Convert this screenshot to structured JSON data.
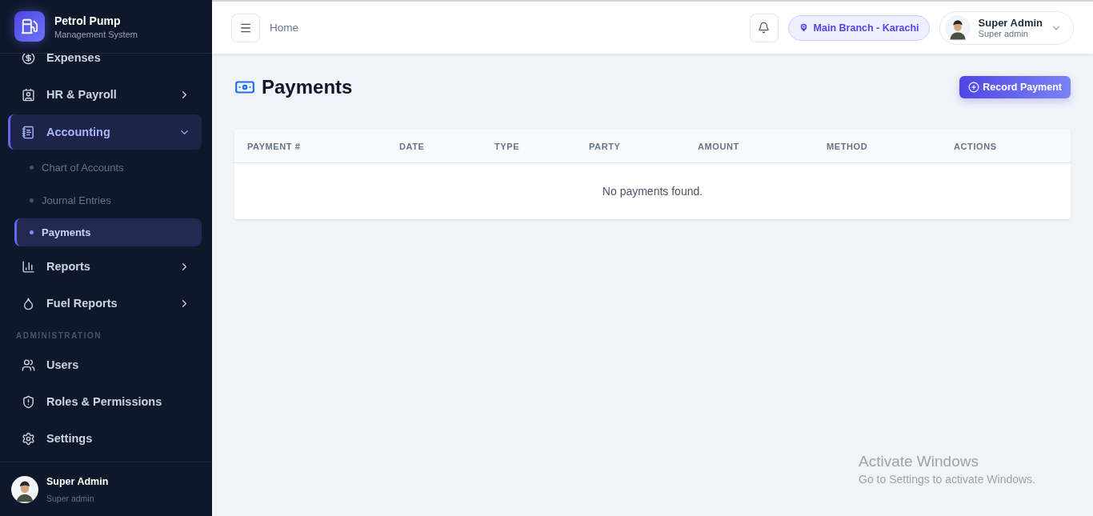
{
  "brand": {
    "title": "Petrol Pump",
    "subtitle": "Management System"
  },
  "sidebar": {
    "items": [
      {
        "kind": "item",
        "label": "Expenses",
        "has_arrow": false
      },
      {
        "kind": "item",
        "label": "HR & Payroll",
        "has_arrow": true,
        "expanded": false
      },
      {
        "kind": "item",
        "label": "Accounting",
        "has_arrow": true,
        "expanded": true,
        "children": [
          {
            "label": "Chart of Accounts",
            "selected": false
          },
          {
            "label": "Journal Entries",
            "selected": false
          },
          {
            "label": "Payments",
            "selected": true
          }
        ]
      },
      {
        "kind": "item",
        "label": "Reports",
        "has_arrow": true,
        "expanded": false
      },
      {
        "kind": "item",
        "label": "Fuel Reports",
        "has_arrow": true,
        "expanded": false
      },
      {
        "kind": "section",
        "label": "ADMINISTRATION"
      },
      {
        "kind": "item",
        "label": "Users",
        "has_arrow": false
      },
      {
        "kind": "item",
        "label": "Roles & Permissions",
        "has_arrow": false
      },
      {
        "kind": "item",
        "label": "Settings",
        "has_arrow": false
      }
    ],
    "user": {
      "name": "Super Admin",
      "role": "Super admin"
    }
  },
  "header": {
    "breadcrumb": "Home",
    "branch": "Main Branch - Karachi",
    "user": {
      "name": "Super Admin",
      "role": "Super admin"
    }
  },
  "page": {
    "title": "Payments",
    "action": "Record Payment"
  },
  "table": {
    "columns": [
      "PAYMENT #",
      "DATE",
      "TYPE",
      "PARTY",
      "AMOUNT",
      "METHOD",
      "ACTIONS"
    ],
    "empty_message": "No payments found."
  },
  "os_notice": {
    "title": "Activate Windows",
    "text": "Go to Settings to activate Windows."
  }
}
